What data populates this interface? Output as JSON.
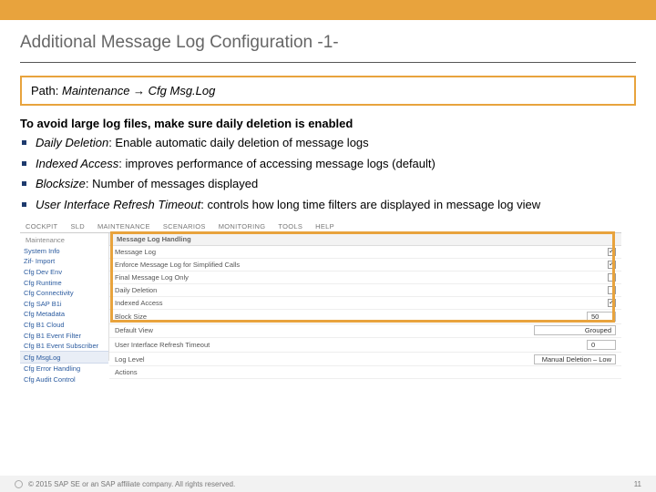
{
  "title": "Additional Message Log Configuration -1-",
  "path": {
    "label": "Path:",
    "value": "Maintenance → Cfg Msg.Log"
  },
  "intro": "To avoid large log files, make sure daily deletion is enabled",
  "bullets": [
    {
      "term": "Daily Deletion",
      "rest": ": Enable automatic daily deletion of message logs"
    },
    {
      "term": "Indexed Access",
      "rest": ": improves performance of accessing message logs (default)"
    },
    {
      "term": "Blocksize",
      "rest": ": Number of messages displayed"
    },
    {
      "term": "User Interface Refresh Timeout",
      "rest": ": controls how long time filters are displayed in message log view"
    }
  ],
  "mini": {
    "menubar": [
      "COCKPIT",
      "SLD",
      "MAINTENANCE",
      "SCENARIOS",
      "MONITORING",
      "TOOLS",
      "HELP"
    ],
    "sidebarHead": "Maintenance",
    "sidebar": [
      "System Info",
      "Zif- Import",
      "Cfg Dev Env",
      "Cfg Runtime",
      "Cfg Connectivity",
      "Cfg SAP B1i",
      "Cfg Metadata",
      "Cfg B1 Cloud",
      "Cfg B1 Event Filter",
      "Cfg B1 Event Subscriber",
      "Cfg MsgLog",
      "Cfg Error Handling",
      "Cfg Audit Control"
    ],
    "selectedSidebarIndex": 10,
    "mainHead": "Message Log Handling",
    "rows": [
      {
        "label": "Message Log",
        "type": "check",
        "on": true
      },
      {
        "label": "Enforce Message Log for Simplified Calls",
        "type": "check",
        "on": true
      },
      {
        "label": "Final Message Log Only",
        "type": "check",
        "on": false
      },
      {
        "label": "Daily Deletion",
        "type": "check",
        "on": false
      },
      {
        "label": "Indexed Access",
        "type": "check",
        "on": true
      },
      {
        "label": "Block Size",
        "type": "num",
        "val": "50"
      },
      {
        "label": "Default View",
        "type": "select",
        "val": "Grouped"
      },
      {
        "label": "User Interface Refresh Timeout",
        "type": "num",
        "val": "0"
      },
      {
        "label": "Log Level",
        "type": "select",
        "val": "Manual Deletion – Low"
      },
      {
        "label": "Actions",
        "type": "text",
        "val": ""
      }
    ]
  },
  "footer": {
    "copyright": "© 2015 SAP SE or an SAP affiliate company. All rights reserved.",
    "page": "11"
  }
}
